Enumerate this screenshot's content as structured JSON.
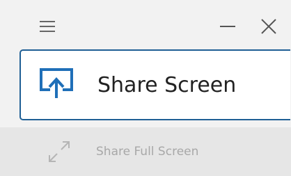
{
  "titlebar": {
    "menu_icon": "hamburger-menu-icon",
    "minimize_icon": "minimize-icon",
    "close_icon": "close-icon"
  },
  "share_screen": {
    "label": "Share Screen",
    "icon": "share-screen-icon",
    "border_color": "#1f5f95",
    "icon_color": "#1f6fb8"
  },
  "share_full_screen": {
    "label": "Share Full Screen",
    "icon": "expand-arrows-icon",
    "disabled": true
  }
}
